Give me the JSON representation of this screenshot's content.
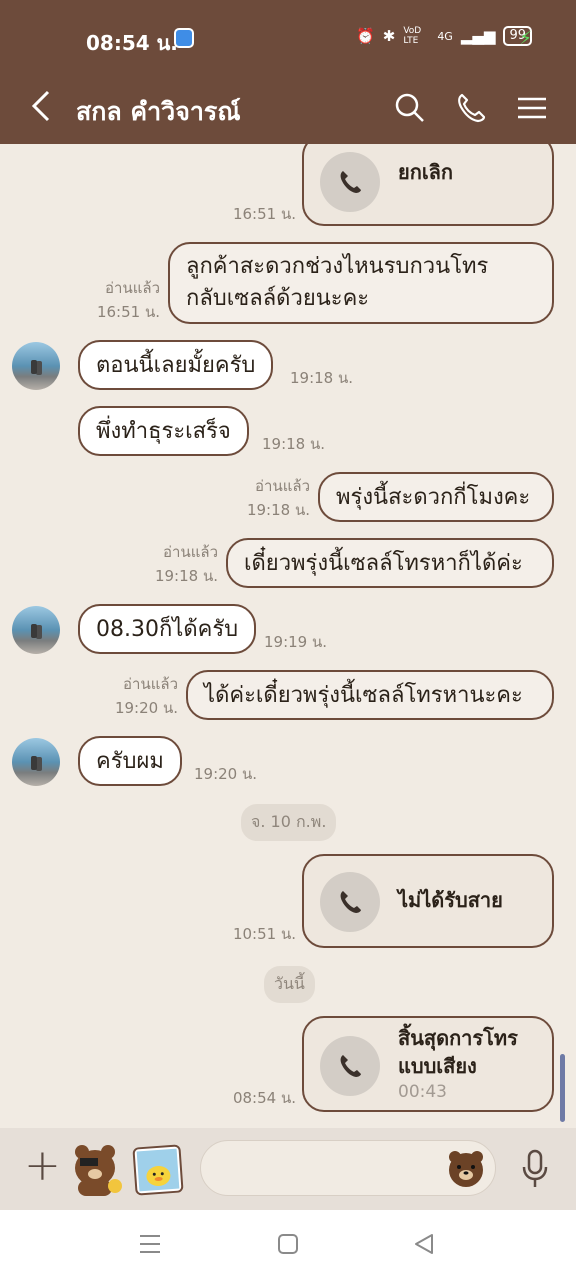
{
  "status_bar": {
    "time": "08:54 น.",
    "network": "VoD LTE",
    "signal": "4G",
    "battery": "99"
  },
  "header": {
    "contact_name": "สกล คำวิจารณ์"
  },
  "messages": [
    {
      "type": "call",
      "side": "out",
      "label": "ยกเลิก",
      "time": "16:51 น."
    },
    {
      "type": "text",
      "side": "out",
      "lines": [
        "ลูกค้าสะดวกช่วงไหนรบกวนโทร",
        "กลับเซลล์ด้วยนะคะ"
      ],
      "read": "อ่านแล้ว",
      "time": "16:51 น."
    },
    {
      "type": "text",
      "side": "in",
      "text": "ตอนนี้เลยมั้ยครับ",
      "time": "19:18 น."
    },
    {
      "type": "text",
      "side": "in",
      "text": "พึ่งทำธุระเสร็จ",
      "time": "19:18 น."
    },
    {
      "type": "text",
      "side": "out",
      "text": "พรุ่งนี้สะดวกกี่โมงคะ",
      "read": "อ่านแล้ว",
      "time": "19:18 น."
    },
    {
      "type": "text",
      "side": "out",
      "text": "เดี๋ยวพรุ่งนี้เซลล์โทรหาก็ได้ค่ะ",
      "read": "อ่านแล้ว",
      "time": "19:18 น."
    },
    {
      "type": "text",
      "side": "in",
      "text": "08.30ก็ได้ครับ",
      "time": "19:19 น."
    },
    {
      "type": "text",
      "side": "out",
      "text": "ได้ค่ะเดี๋ยวพรุ่งนี้เซลล์โทรหานะคะ",
      "read": "อ่านแล้ว",
      "time": "19:20 น."
    },
    {
      "type": "text",
      "side": "in",
      "text": "ครับผม",
      "time": "19:20 น."
    },
    {
      "type": "date",
      "text": "จ. 10 ก.พ."
    },
    {
      "type": "call",
      "side": "out",
      "label": "ไม่ได้รับสาย",
      "time": "10:51 น."
    },
    {
      "type": "date",
      "text": "วันนี้"
    },
    {
      "type": "call",
      "side": "out",
      "label_lines": [
        "สิ้นสุดการโทร",
        "แบบเสียง"
      ],
      "duration": "00:43",
      "time": "08:54 น."
    }
  ],
  "colors": {
    "header": "#6d4b3b",
    "background": "#f1ebe3",
    "bubble_border": "#6d4b3b"
  }
}
